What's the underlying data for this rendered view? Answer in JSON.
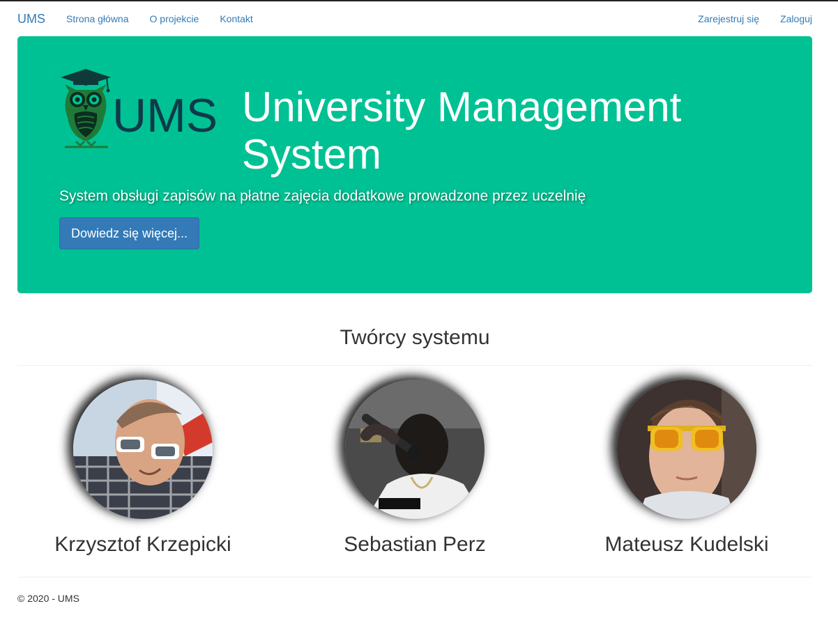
{
  "navbar": {
    "brand": "UMS",
    "left_links": [
      "Strona główna",
      "O projekcie",
      "Kontakt"
    ],
    "right_links": [
      "Zarejestruj się",
      "Zaloguj"
    ]
  },
  "hero": {
    "logo_text": "UMS",
    "title": "University Management System",
    "subtitle": "System obsługi zapisów na płatne zajęcia dodatkowe prowadzone przez uczelnię",
    "button_label": "Dowiedz się więcej...",
    "background_color": "#00c194",
    "button_color": "#337ab7"
  },
  "creators": {
    "title": "Twórcy systemu",
    "people": [
      {
        "name": "Krzysztof Krzepicki"
      },
      {
        "name": "Sebastian Perz"
      },
      {
        "name": "Mateusz Kudelski"
      }
    ]
  },
  "footer": {
    "text": "© 2020 - UMS"
  }
}
